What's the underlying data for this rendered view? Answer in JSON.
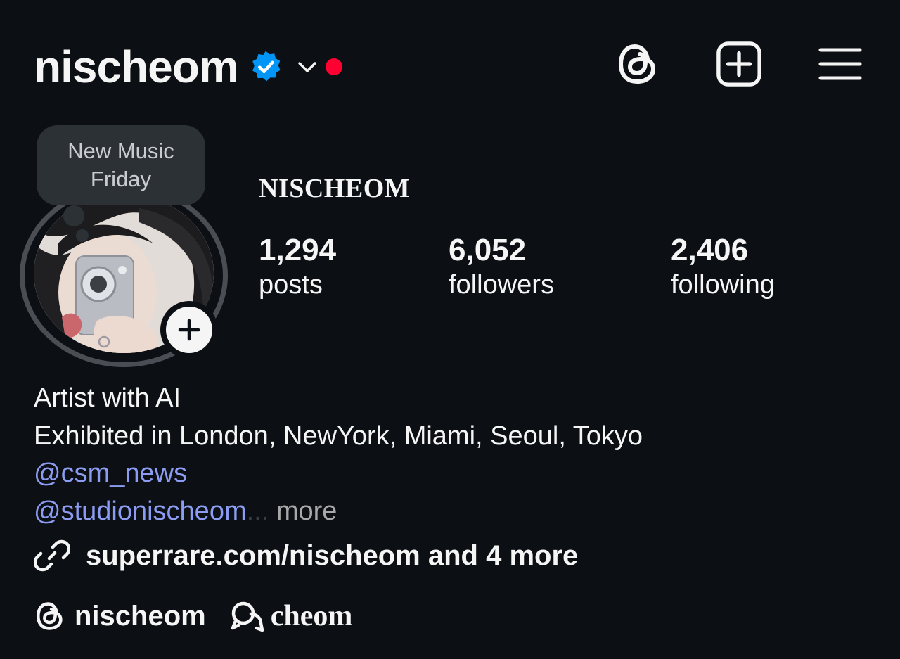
{
  "header": {
    "username": "nischeom",
    "verified_icon": "verified-badge-icon",
    "dropdown_icon": "chevron-down-icon",
    "notification_color": "#ff0033",
    "actions": [
      {
        "icon": "threads-icon"
      },
      {
        "icon": "create-post-icon"
      },
      {
        "icon": "menu-icon"
      }
    ]
  },
  "note": {
    "text": "New Music Friday"
  },
  "profile": {
    "display_name": "NISCHEOM",
    "stats": [
      {
        "value": "1,294",
        "label": "posts"
      },
      {
        "value": "6,052",
        "label": "followers"
      },
      {
        "value": "2,406",
        "label": "following"
      }
    ]
  },
  "bio": {
    "line1": "Artist with AI",
    "line2": "Exhibited in London, NewYork, Miami, Seoul, Tokyo",
    "mention1": "@csm_news",
    "mention2": "@studionischeom",
    "ellipsis": "...",
    "more": " more"
  },
  "link": {
    "text": "superrare.com/nischeom and 4 more"
  },
  "social": {
    "threads_handle": "nischeom",
    "other_handle": "cheom"
  },
  "colors": {
    "background": "#0c1014",
    "mention": "#8c9cf2",
    "verified": "#0095f6"
  }
}
